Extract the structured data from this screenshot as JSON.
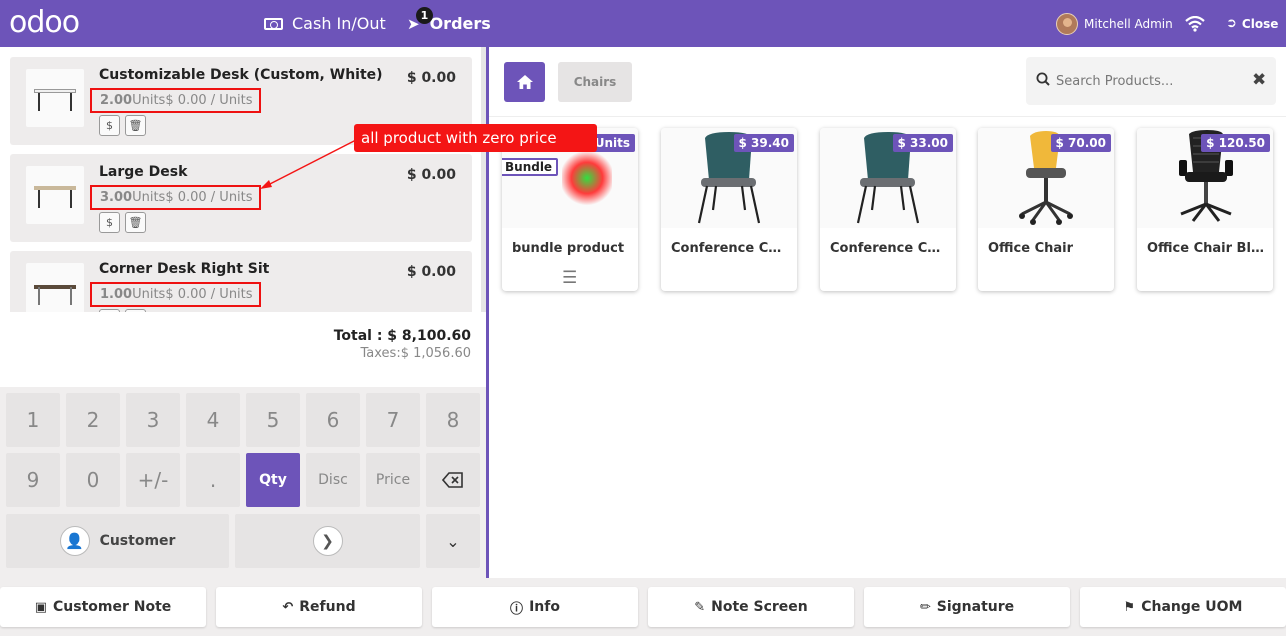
{
  "header": {
    "logo": "odoo",
    "cash_label": "Cash In/Out",
    "orders_label": "Orders",
    "orders_count": "1",
    "user_name": "Mitchell Admin",
    "close_label": "Close"
  },
  "order": {
    "lines": [
      {
        "name": "Customizable Desk (Custom, White)",
        "price": "$ 0.00",
        "qty": "2.00",
        "unit_text": "Units$ 0.00 / Units"
      },
      {
        "name": "Large Desk",
        "price": "$ 0.00",
        "qty": "3.00",
        "unit_text": "Units$ 0.00 / Units"
      },
      {
        "name": "Corner Desk Right Sit",
        "price": "$ 0.00",
        "qty": "1.00",
        "unit_text": "Units$ 0.00 / Units"
      }
    ],
    "line_price_icon": "$",
    "total": "Total : $ 8,100.60",
    "taxes": "Taxes:$ 1,056.60"
  },
  "numpad": {
    "keys": [
      "1",
      "2",
      "3",
      "4",
      "5",
      "6",
      "7",
      "8",
      "9",
      "0",
      "+/-",
      "."
    ],
    "qty": "Qty",
    "disc": "Disc",
    "price": "Price",
    "customer": "Customer"
  },
  "categories": {
    "current": "Chairs"
  },
  "search": {
    "placeholder": "Search Products..."
  },
  "products": [
    {
      "name": "bundle product",
      "price": "0/Units",
      "badge": "Bundle"
    },
    {
      "name": "Conference Chair (Steel)",
      "price": "$ 39.40"
    },
    {
      "name": "Conference Chair (Aluminium)",
      "price": "$ 33.00"
    },
    {
      "name": "Office Chair",
      "price": "$ 70.00"
    },
    {
      "name": "Office Chair Black",
      "price": "$ 120.50"
    }
  ],
  "footer": {
    "customer_note": "Customer Note",
    "refund": "Refund",
    "info": "Info",
    "note_screen": "Note Screen",
    "signature": "Signature",
    "change_uom": "Change UOM"
  },
  "annotation": {
    "text": "all product with zero price"
  },
  "colors": {
    "brand": "#6d54b9",
    "annotation": "#f41515"
  }
}
